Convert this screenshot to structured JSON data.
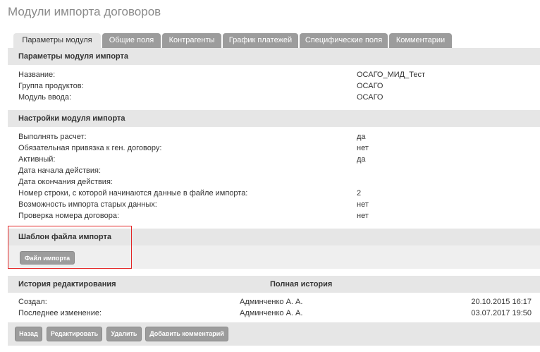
{
  "page": {
    "title": "Модули импорта договоров"
  },
  "tabs": [
    {
      "label": "Параметры модуля",
      "active": true
    },
    {
      "label": "Общие поля",
      "active": false
    },
    {
      "label": "Контрагенты",
      "active": false
    },
    {
      "label": "График платежей",
      "active": false
    },
    {
      "label": "Специфические поля",
      "active": false
    },
    {
      "label": "Комментарии",
      "active": false
    }
  ],
  "params": {
    "heading": "Параметры модуля импорта",
    "rows": [
      {
        "label": "Название:",
        "value": "ОСАГО_МИД_Тест"
      },
      {
        "label": "Группа продуктов:",
        "value": "ОСАГО"
      },
      {
        "label": "Модуль ввода:",
        "value": "ОСАГО"
      }
    ]
  },
  "settings": {
    "heading": "Настройки модуля импорта",
    "rows": [
      {
        "label": "Выполнять расчет:",
        "value": "да"
      },
      {
        "label": "Обязательная привязка к ген. договору:",
        "value": "нет"
      },
      {
        "label": "Активный:",
        "value": "да"
      },
      {
        "label": "Дата начала действия:",
        "value": ""
      },
      {
        "label": "Дата окончания действия:",
        "value": ""
      },
      {
        "label": "Номер строки, с которой начинаются данные в файле импорта:",
        "value": "2"
      },
      {
        "label": "Возможность импорта старых данных:",
        "value": "нет"
      },
      {
        "label": "Проверка номера договора:",
        "value": "нет"
      }
    ]
  },
  "template": {
    "heading": "Шаблон файла импорта",
    "button_label": "Файл импорта"
  },
  "history": {
    "heading": "История редактирования",
    "full_history_label": "Полная история",
    "rows": [
      {
        "label": "Создал:",
        "user": "Админченко А. А.",
        "date": "20.10.2015 16:17"
      },
      {
        "label": "Последнее изменение:",
        "user": "Админченко А. А.",
        "date": "03.07.2017 19:50"
      }
    ]
  },
  "footer": {
    "back_label": "Назад",
    "edit_label": "Редактировать",
    "delete_label": "Удалить",
    "comment_label": "Добавить комментарий"
  },
  "colors": {
    "highlight": "#e32626",
    "tab_inactive": "#9c9c9c",
    "section_bg": "#e6e6e6"
  }
}
